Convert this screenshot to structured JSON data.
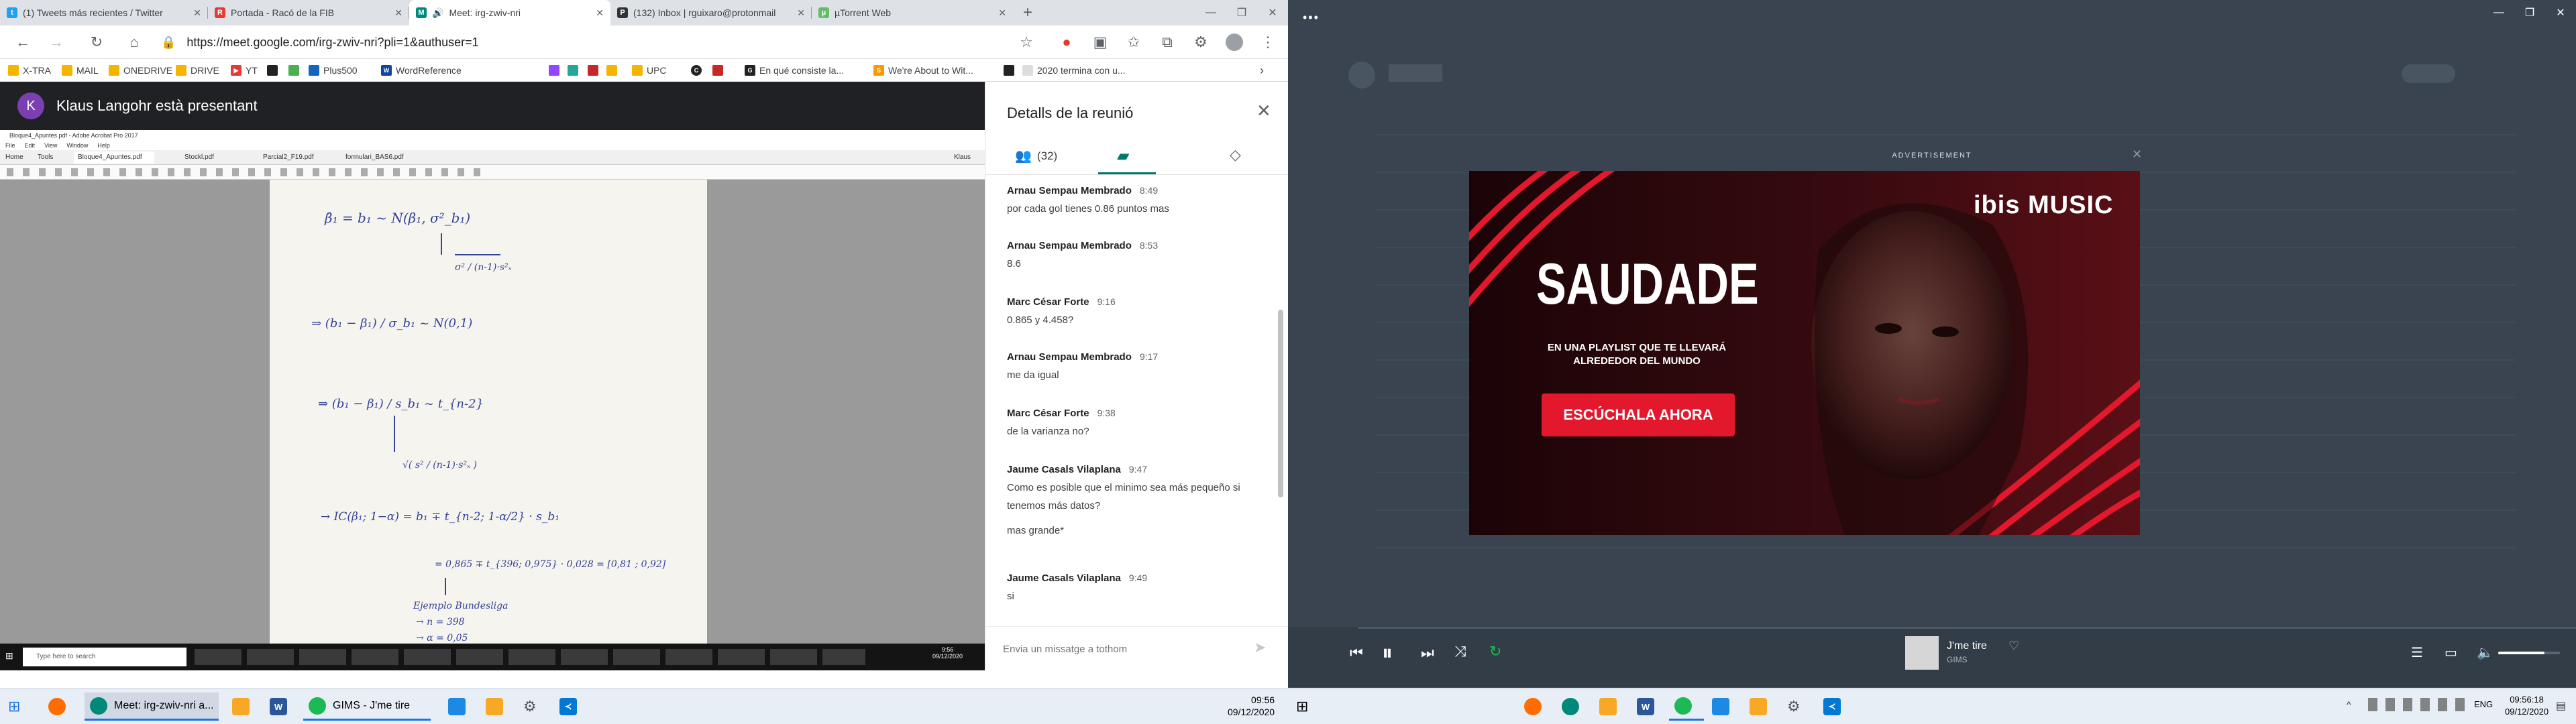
{
  "browser": {
    "tabs": [
      {
        "title": "(1) Tweets más recientes / Twitter",
        "icon": "twitter-icon",
        "color": "#1da1f2"
      },
      {
        "title": "Portada - Racó de la FIB",
        "icon": "raco-icon",
        "color": "#e53935"
      },
      {
        "title": "Meet: irg-zwiv-nri",
        "icon": "meet-icon",
        "color": "#00897b"
      },
      {
        "title": "(132) Inbox | rguixaro@protonmail",
        "icon": "protonmail-icon",
        "color": "#333333"
      },
      {
        "title": "µTorrent Web",
        "icon": "utorrent-icon",
        "color": "#66bb6a"
      }
    ],
    "url": "https://meet.google.com/irg-zwiv-nri?pli=1&authuser=1",
    "bookmarks": [
      "X-TRA",
      "MAIL",
      "ONEDRIVE",
      "DRIVE",
      "YT",
      "",
      "Plus500",
      "WordReference",
      "",
      "",
      "",
      "UPC",
      "",
      "En qué consiste la...",
      "We're About to Wit...",
      "",
      "2020 termina con u..."
    ]
  },
  "meet": {
    "presenter_initial": "K",
    "presenter_text": "Klaus Langohr està presentant",
    "shared_window": {
      "title": "Bloque4_Apuntes.pdf - Adobe Acrobat Pro 2017",
      "menu": [
        "File",
        "Edit",
        "View",
        "Window",
        "Help"
      ],
      "tabs": [
        "Home",
        "Tools",
        "Bloque4_Apuntes.pdf",
        "Stockl.pdf",
        "Parcial2_F19.pdf",
        "formulari_BAS6.pdf"
      ],
      "user": "Klaus",
      "taskbar_search": "Type here to search",
      "taskbar_time": "9:56",
      "taskbar_date": "09/12/2020"
    },
    "handwriting": [
      "β̂₁ = b₁ ~ N(β₁, σ²_b₁)",
      "σ² / (n-1)·s²ₓ",
      "⇒   (b₁ − β₁) / σ_b₁  ~ N(0,1)",
      "⇒   (b₁ − β₁) / s_b₁  ~ t_{n-2}",
      "√( s² / (n-1)·s²ₓ )",
      "→  IC(β₁; 1−α) = b₁ ∓ t_{n-2; 1-α/2} · s_b₁",
      "= 0,865 ∓ t_{396; 0,975} · 0,028 = [0,81 ; 0,92]",
      "Ejemplo Bundesliga",
      "→ n = 398",
      "→ α = 0,05"
    ]
  },
  "details": {
    "title": "Detalls de la reunió",
    "people_count": "(32)",
    "messages": [
      {
        "author": "Arnau Sempau Membrado",
        "time": "8:49",
        "lines": [
          "por cada gol tienes 0.86 puntos mas"
        ]
      },
      {
        "author": "Arnau Sempau Membrado",
        "time": "8:53",
        "lines": [
          "8.6"
        ]
      },
      {
        "author": "Marc César Forte",
        "time": "9:16",
        "lines": [
          "0.865 y 4.458?"
        ]
      },
      {
        "author": "Arnau Sempau Membrado",
        "time": "9:17",
        "lines": [
          "me da igual"
        ]
      },
      {
        "author": "Marc César Forte",
        "time": "9:38",
        "lines": [
          "de la varianza no?"
        ]
      },
      {
        "author": "Jaume Casals Vilaplana",
        "time": "9:47",
        "lines": [
          "Como es posible que el minimo sea más pequeño si tenemos más datos?",
          "mas grande*"
        ]
      },
      {
        "author": "Jaume Casals Vilaplana",
        "time": "9:49",
        "lines": [
          "si"
        ]
      }
    ],
    "input_placeholder": "Envia un missatge a tothom"
  },
  "taskbar_left": {
    "items": [
      {
        "label": "Meet: irg-zwiv-nri a...",
        "color": "#00897b"
      },
      {
        "label": "GIMS - J'me tire",
        "color": "#1db954"
      }
    ],
    "time": "09:56",
    "date": "09/12/2020"
  },
  "spotify": {
    "menu_dots": "•••",
    "ad_label": "ADVERTISEMENT",
    "ad_brand": "ibis MUSIC",
    "ad_headline": "SAUDADE",
    "ad_sub": "EN UNA PLAYLIST QUE TE LLEVARÁ ALREDEDOR DEL MUNDO",
    "ad_cta": "ESCÚCHALA AHORA",
    "track": "J'me tire",
    "artist": "GIMS",
    "progress": 0.0,
    "volume": 0.75
  },
  "taskbar_right": {
    "lang": "ENG",
    "time": "09:56:18",
    "date": "09/12/2020"
  }
}
